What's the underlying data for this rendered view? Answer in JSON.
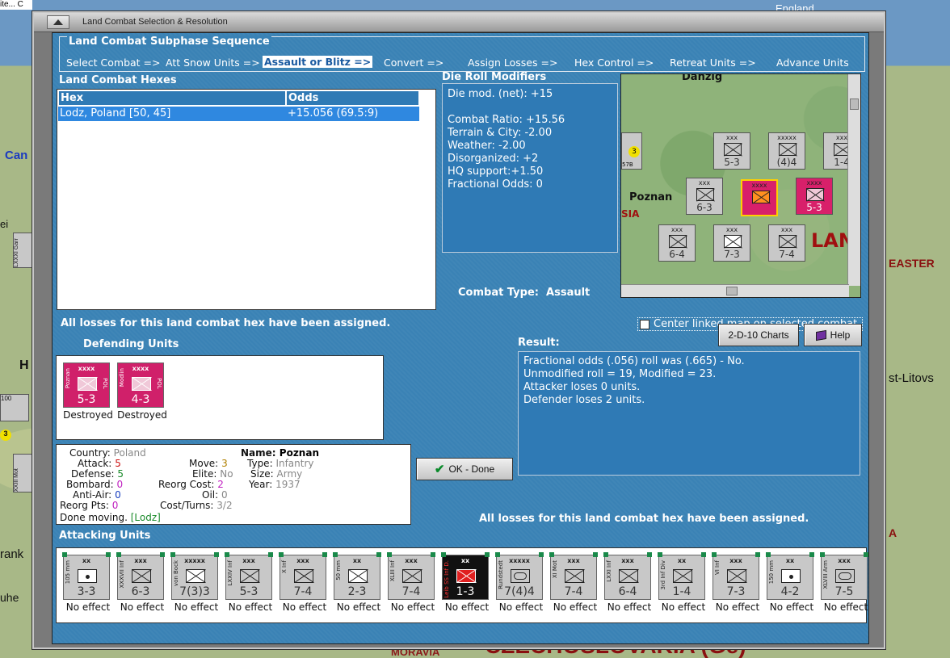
{
  "background": {
    "country": "England",
    "labels": [
      "Can",
      "ei",
      "H",
      "rank",
      "uhe",
      "MORAVIA",
      "CZECHOSLOVAKIA (Ge)",
      "EASTER",
      "A",
      "st-Litovs"
    ],
    "left_counters": [
      "LXXXI Garr",
      "100",
      "3",
      "XXIII Mot"
    ],
    "top_left_text": "ite... C"
  },
  "window": {
    "title": "Land Combat Selection & Resolution"
  },
  "sequence": {
    "title": "Land Combat Subphase Sequence",
    "items": [
      {
        "label": "Select Combat =>",
        "active": false
      },
      {
        "label": "Att Snow Units =>",
        "active": false
      },
      {
        "label": "Assault or Blitz =>",
        "active": true
      },
      {
        "label": "Convert =>",
        "active": false
      },
      {
        "label": "Assign Losses =>",
        "active": false
      },
      {
        "label": "Hex Control =>",
        "active": false
      },
      {
        "label": "Retreat Units =>",
        "active": false
      },
      {
        "label": "Advance Units",
        "active": false
      }
    ]
  },
  "hexes": {
    "title": "Land Combat Hexes",
    "columns": [
      "Hex",
      "Odds"
    ],
    "rows": [
      {
        "hex": "Lodz, Poland [50, 45]",
        "odds": "+15.056 (69.5:9)"
      }
    ],
    "status": "All losses for this land combat hex have been assigned."
  },
  "die_roll": {
    "title": "Die Roll Modifiers",
    "lines": [
      "Die mod. (net): +15",
      "",
      "Combat Ratio: +15.56",
      "Terrain & City: -2.00",
      "Weather: -2.00",
      "Disorganized: +2",
      "HQ support:+1.50",
      "Fractional Odds: 0"
    ]
  },
  "minimap": {
    "labels": [
      "Danzig",
      "Poznan",
      "SIA",
      "LAN",
      "3",
      "57B"
    ],
    "counters": [
      {
        "size": "xxx",
        "value": "5-3",
        "red": false
      },
      {
        "size": "xxxxx",
        "value": "(4)4",
        "red": false
      },
      {
        "size": "xxx",
        "value": "1-4",
        "red": false
      },
      {
        "size": "xxx",
        "value": "6-3",
        "red": false
      },
      {
        "size": "xxxx",
        "value": "",
        "red": true
      },
      {
        "size": "xxxx",
        "value": "5-3",
        "red": true
      },
      {
        "size": "xxx",
        "value": "6-4",
        "red": false
      },
      {
        "size": "xxx",
        "value": "7-3",
        "red": false
      },
      {
        "size": "xxx",
        "value": "7-4",
        "red": false
      }
    ]
  },
  "combat_type": {
    "label": "Combat Type:",
    "value": "Assault"
  },
  "center_map": {
    "label": "Center linked map on selected combat.",
    "checked": false
  },
  "buttons": {
    "charts": "2-D-10 Charts",
    "help": "Help",
    "ok": "OK - Done"
  },
  "result": {
    "title": "Result:",
    "lines": [
      "Fractional odds (.056) roll was (.665)  - No.",
      "Unmodified roll = 19, Modified = 23.",
      "Attacker loses 0 units.",
      "Defender loses 2 units."
    ]
  },
  "defenders": {
    "title": "Defending Units",
    "units": [
      {
        "name": "Poznan",
        "size": "xxxx",
        "side": "POL",
        "value": "5-3",
        "status": "Destroyed"
      },
      {
        "name": "Modlin",
        "size": "xxxx",
        "side": "POL",
        "value": "4-3",
        "status": "Destroyed"
      }
    ]
  },
  "unit_info": {
    "country_k": "Country:",
    "country_v": "Poland",
    "attack_k": "Attack:",
    "attack_v": "5",
    "defense_k": "Defense:",
    "defense_v": "5",
    "bombard_k": "Bombard:",
    "bombard_v": "0",
    "antiair_k": "Anti-Air:",
    "antiair_v": "0",
    "reorgpts_k": "Reorg Pts:",
    "reorgpts_v": "0",
    "move_k": "Move:",
    "move_v": "3",
    "elite_k": "Elite:",
    "elite_v": "No",
    "reorgcost_k": "Reorg Cost:",
    "reorgcost_v": "2",
    "oil_k": "Oil:",
    "oil_v": "0",
    "costturns_k": "Cost/Turns:",
    "costturns_v": "3/2",
    "name_k": "Name:",
    "name_v": "Poznan",
    "type_k": "Type:",
    "type_v": "Infantry",
    "size_k": "Size:",
    "size_v": "Army",
    "year_k": "Year:",
    "year_v": "1937",
    "done_k": "Done moving.",
    "done_v": "[Lodz]"
  },
  "status2": "All losses for this land combat hex have been assigned.",
  "attackers": {
    "title": "Attacking Units",
    "units": [
      {
        "name": "105 mm",
        "size": "xx",
        "type": "art",
        "value": "3-3",
        "status": "No effect",
        "style": "grey"
      },
      {
        "name": "XXXVII Inf",
        "size": "xxx",
        "type": "inf",
        "value": "6-3",
        "status": "No effect",
        "style": "grey"
      },
      {
        "name": "von Bock",
        "size": "xxxxx",
        "type": "hq",
        "value": "7(3)3",
        "status": "No effect",
        "style": "grey"
      },
      {
        "name": "LXXIV Inf",
        "size": "xxx",
        "type": "inf",
        "value": "5-3",
        "status": "No effect",
        "style": "grey"
      },
      {
        "name": "X Inf",
        "size": "xxx",
        "type": "inf",
        "value": "7-4",
        "status": "No effect",
        "style": "grey"
      },
      {
        "name": "50 mm",
        "size": "xx",
        "type": "para",
        "value": "2-3",
        "status": "No effect",
        "style": "grey"
      },
      {
        "name": "XLIII Inf",
        "size": "xxx",
        "type": "inf",
        "value": "7-4",
        "status": "No effect",
        "style": "grey"
      },
      {
        "name": "Leib SS Inf D.",
        "size": "xx",
        "type": "inf",
        "value": "1-3",
        "status": "No effect",
        "style": "black"
      },
      {
        "name": "Rundstedt",
        "size": "xxxxx",
        "type": "arm",
        "value": "7(4)4",
        "status": "No effect",
        "style": "grey"
      },
      {
        "name": "XI Mot",
        "size": "xxx",
        "type": "inf",
        "value": "7-4",
        "status": "No effect",
        "style": "grey"
      },
      {
        "name": "LXXI Inf",
        "size": "xxx",
        "type": "inf",
        "value": "6-4",
        "status": "No effect",
        "style": "grey"
      },
      {
        "name": "3rd Inf Div",
        "size": "xx",
        "type": "inf",
        "value": "1-4",
        "status": "No effect",
        "style": "grey"
      },
      {
        "name": "VI Inf",
        "size": "xxx",
        "type": "inf",
        "value": "7-3",
        "status": "No effect",
        "style": "grey"
      },
      {
        "name": "150 mm",
        "size": "xx",
        "type": "art",
        "value": "4-2",
        "status": "No effect",
        "style": "grey"
      },
      {
        "name": "XLVIII Arm",
        "size": "xxx",
        "type": "arm",
        "value": "7-5",
        "status": "No effect",
        "style": "grey"
      }
    ]
  },
  "colors": {
    "panel_blue": "#3a82b5",
    "defender_magenta": "#d0206a",
    "selected_row": "#2f88e0",
    "ok_check": "#0a8a2a",
    "info_red": "#cc1111",
    "info_green": "#1a8a2a",
    "info_magenta": "#c020c0",
    "info_blue": "#1a40c0",
    "info_grey": "#888888",
    "info_orange": "#b08000"
  }
}
